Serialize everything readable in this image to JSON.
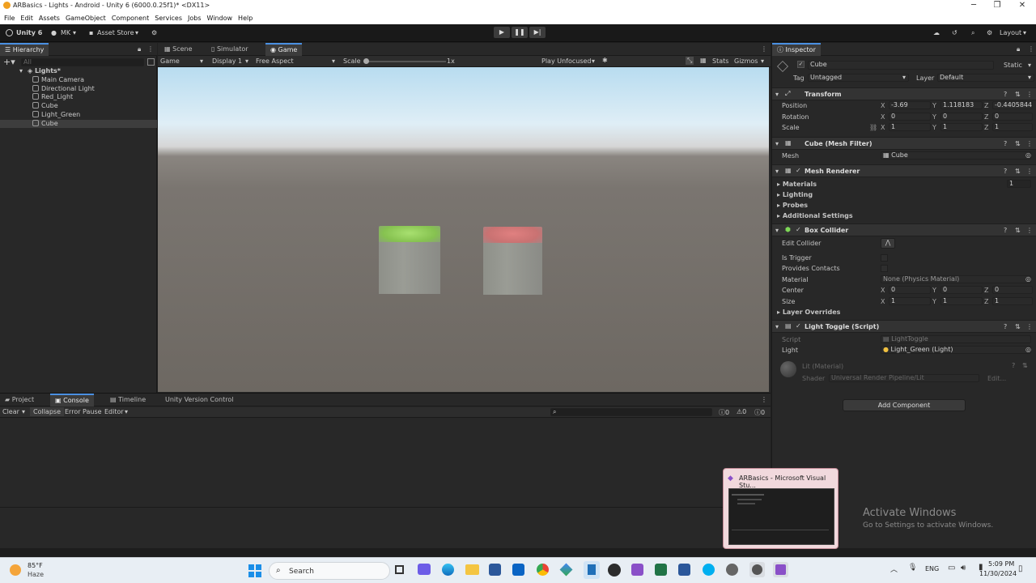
{
  "window": {
    "title": "ARBasics - Lights - Android - Unity 6 (6000.0.25f1)* <DX11>",
    "minimize": "─",
    "maximize": "❐",
    "close": "✕"
  },
  "menu": [
    "File",
    "Edit",
    "Assets",
    "GameObject",
    "Component",
    "Services",
    "Jobs",
    "Window",
    "Help"
  ],
  "toolbar": {
    "unity_label": "Unity 6",
    "account": "MK",
    "asset_store": "Asset Store",
    "layout": "Layout"
  },
  "hierarchy": {
    "tab": "Hierarchy",
    "search_placeholder": "All",
    "scene": "Lights*",
    "items": [
      "Main Camera",
      "Directional Light",
      "Red_Light",
      "Cube",
      "Light_Green",
      "Cube"
    ],
    "selected_index": 5
  },
  "game": {
    "tabs": [
      "Scene",
      "Simulator",
      "Game"
    ],
    "view": "Game",
    "display": "Display 1",
    "aspect": "Free Aspect",
    "scale_label": "Scale",
    "scale_value": "1x",
    "play_mode": "Play Unfocused",
    "stats": "Stats",
    "gizmos": "Gizmos"
  },
  "inspector": {
    "tab": "Inspector",
    "object_name": "Cube",
    "static": "Static",
    "tag_label": "Tag",
    "tag_value": "Untagged",
    "layer_label": "Layer",
    "layer_value": "Default",
    "transform": {
      "title": "Transform",
      "position_label": "Position",
      "position": {
        "x": "-3.69",
        "y": "1.118183",
        "z": "-0.4405844"
      },
      "rotation_label": "Rotation",
      "rotation": {
        "x": "0",
        "y": "0",
        "z": "0"
      },
      "scale_label": "Scale",
      "scale": {
        "x": "1",
        "y": "1",
        "z": "1"
      }
    },
    "mesh_filter": {
      "title": "Cube (Mesh Filter)",
      "mesh_label": "Mesh",
      "mesh_value": "Cube"
    },
    "mesh_renderer": {
      "title": "Mesh Renderer",
      "materials": "Materials",
      "materials_count": "1",
      "lighting": "Lighting",
      "probes": "Probes",
      "additional": "Additional Settings"
    },
    "box_collider": {
      "title": "Box Collider",
      "edit_collider": "Edit Collider",
      "is_trigger": "Is Trigger",
      "provides_contacts": "Provides Contacts",
      "material_label": "Material",
      "material_value": "None (Physics Material)",
      "center_label": "Center",
      "center": {
        "x": "0",
        "y": "0",
        "z": "0"
      },
      "size_label": "Size",
      "size": {
        "x": "1",
        "y": "1",
        "z": "1"
      },
      "layer_overrides": "Layer Overrides"
    },
    "light_toggle": {
      "title": "Light Toggle (Script)",
      "script_label": "Script",
      "script_value": "LightToggle",
      "light_label": "Light",
      "light_value": "Light_Green (Light)"
    },
    "material": {
      "name": "Lit (Material)",
      "shader_label": "Shader",
      "shader_value": "Universal Render Pipeline/Lit",
      "edit": "Edit..."
    },
    "add_component": "Add Component"
  },
  "console": {
    "tabs": [
      "Project",
      "Console",
      "Timeline",
      "Unity Version Control"
    ],
    "clear": "Clear",
    "collapse": "Collapse",
    "error_pause": "Error Pause",
    "editor": "Editor",
    "counts": [
      "0",
      "0",
      "0"
    ]
  },
  "watermark": {
    "line1": "Activate Windows",
    "line2": "Go to Settings to activate Windows."
  },
  "popup": {
    "title": "ARBasics - Microsoft Visual Stu..."
  },
  "taskbar": {
    "weather_temp": "85°F",
    "weather_desc": "Haze",
    "search": "Search",
    "lang": "ENG",
    "time": "5:09 PM",
    "date": "11/30/2024"
  },
  "colors": {
    "accent": "#4a90e2",
    "green_light": "#8fd35a",
    "red_light": "#d86a6a"
  }
}
